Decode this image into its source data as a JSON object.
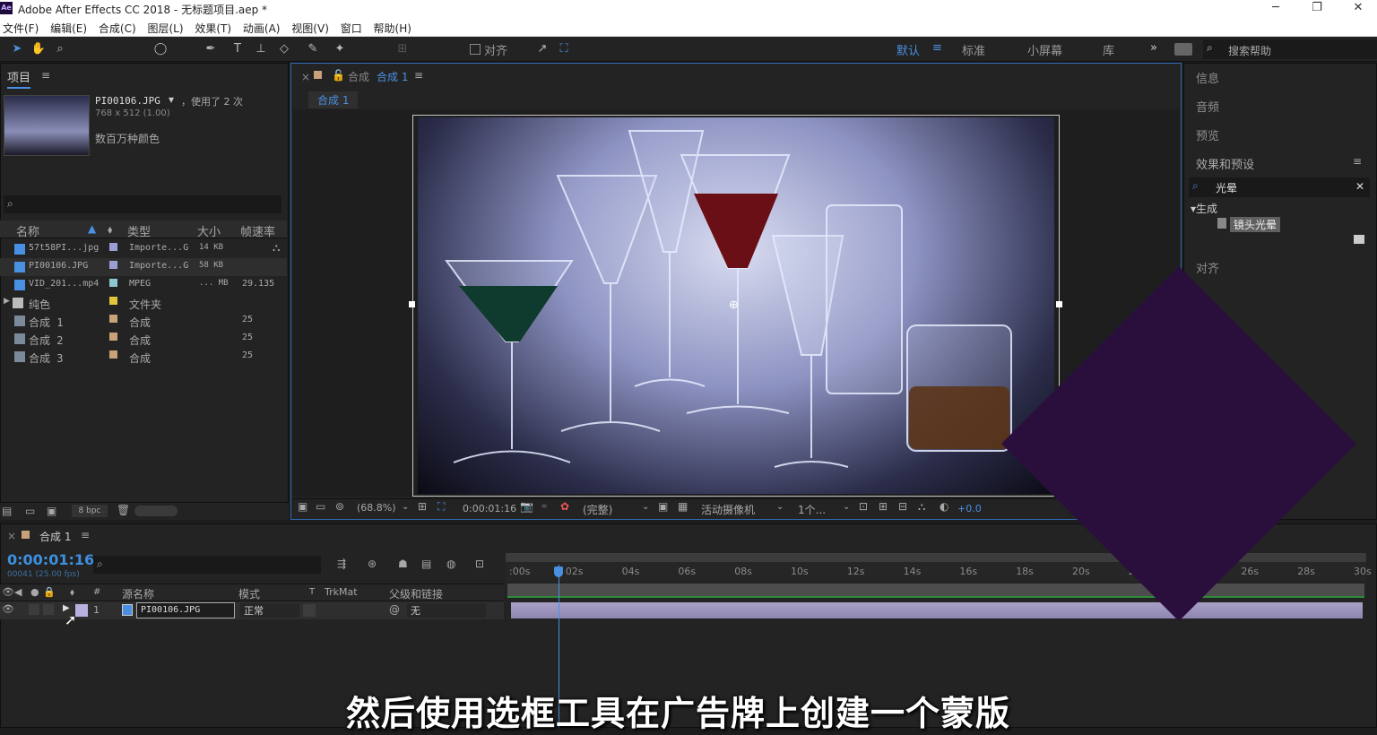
{
  "window": {
    "title": "Adobe After Effects CC 2018 - 无标题项目.aep *",
    "minimize": "─",
    "restore": "❐",
    "close": "✕",
    "logo": "Ae"
  },
  "menu": [
    "文件(F)",
    "编辑(E)",
    "合成(C)",
    "图层(L)",
    "效果(T)",
    "动画(A)",
    "视图(V)",
    "窗口",
    "帮助(H)"
  ],
  "toolbar": {
    "align_label": "对齐",
    "workspaces": [
      "默认",
      "标准",
      "小屏幕",
      "库"
    ],
    "active_ws": "默认",
    "more": "»",
    "help_placeholder": "搜索帮助"
  },
  "project": {
    "tab": "项目",
    "menu_icon": "≡",
    "selected": {
      "name": "PI00106.JPG",
      "used": "，使用了 2 次",
      "dims": "768 x 512 (1.00)",
      "colors": "数百万种颜色"
    },
    "columns": [
      "名称",
      "类型",
      "大小",
      "帧速率"
    ],
    "items": [
      {
        "name": "57t58PI...jpg",
        "type": "Importe...G",
        "size": "14 KB",
        "fps": "",
        "color": "#9d9dd6"
      },
      {
        "name": "PI00106.JPG",
        "type": "Importe...G",
        "size": "58 KB",
        "fps": "",
        "color": "#9d9dd6"
      },
      {
        "name": "VID_201...mp4",
        "type": "MPEG",
        "size": "... MB",
        "fps": "29.135",
        "color": "#8fc8d0"
      },
      {
        "name": "纯色",
        "type": "文件夹",
        "size": "",
        "fps": "",
        "color": "#e2c53a"
      },
      {
        "name": "合成 1",
        "type": "合成",
        "size": "",
        "fps": "25",
        "color": "#c9a27a"
      },
      {
        "name": "合成 2",
        "type": "合成",
        "size": "",
        "fps": "25",
        "color": "#c9a27a"
      },
      {
        "name": "合成 3",
        "type": "合成",
        "size": "",
        "fps": "25",
        "color": "#c9a27a"
      }
    ],
    "bpc": "8 bpc"
  },
  "composition": {
    "tab_prefix": "合成",
    "tab_name": "合成 1",
    "breadcrumb": "合成 1",
    "zoom": "(68.8%)",
    "timecode": "0:00:01:16",
    "resolution": "(完整)",
    "camera": "活动摄像机",
    "views": "1个...",
    "exposure": "+0.0"
  },
  "right_panel": {
    "items": [
      "信息",
      "音频",
      "预览",
      "效果和预设"
    ],
    "search_value": "光晕",
    "tree_group": "▾生成",
    "tree_item": "镜头光晕",
    "align": "对齐"
  },
  "timeline": {
    "tab": "合成 1",
    "timecode": "0:00:01:16",
    "frame_info": "00041 (25.00 fps)",
    "columns": {
      "source": "源名称",
      "mode": "模式",
      "t": "T",
      "trkmat": "TrkMat",
      "parent": "父级和链接"
    },
    "layer": {
      "index": "1",
      "name": "PI00106.JPG",
      "mode": "正常",
      "parent": "无"
    },
    "ticks": [
      ":00s",
      "02s",
      "04s",
      "06s",
      "08s",
      "10s",
      "12s",
      "14s",
      "16s",
      "18s",
      "20s",
      "22s",
      "24s",
      "26s",
      "28s",
      "30s"
    ],
    "playhead_seconds": 1.64,
    "duration_seconds": 30
  },
  "subtitle": "然后使用选框工具在广告牌上创建一个蒙版",
  "overlay_color": "#2a0f3d"
}
